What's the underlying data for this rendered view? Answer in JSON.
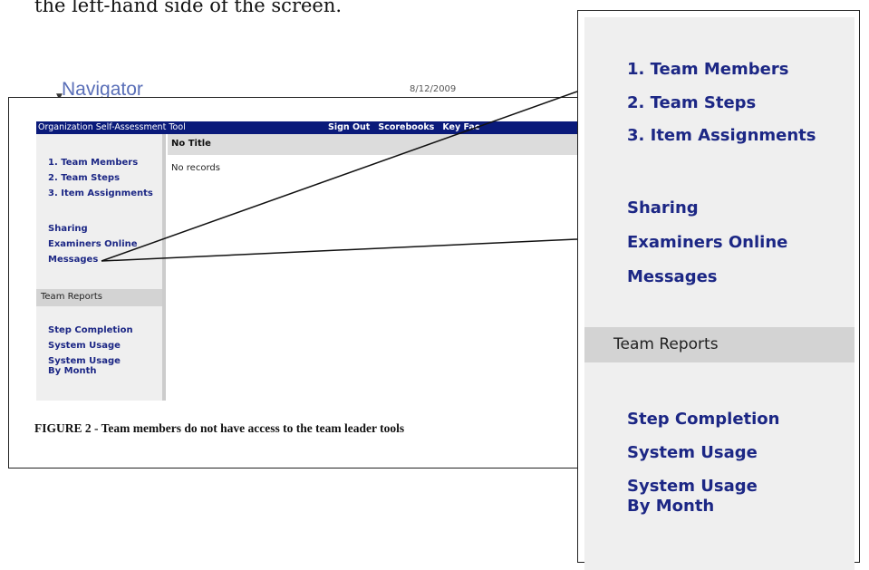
{
  "document": {
    "intro_text": "the left-hand side of the screen.",
    "caption": "FIGURE 2 - Team members do not have access to the team leader tools"
  },
  "browser": {
    "heading": "Navigator",
    "date": "8/12/2009"
  },
  "app": {
    "title": "Organization Self-Assessment Tool",
    "top_links": [
      "Sign Out",
      "Scorebooks",
      "Key Fac"
    ],
    "bar_color": "#0a1a7a"
  },
  "sidebar": {
    "team_links": [
      "1. Team Members",
      "2. Team Steps",
      "3. Item Assignments"
    ],
    "general_links": [
      "Sharing",
      "Examiners Online",
      "Messages"
    ],
    "section_title": "Team Reports",
    "report_links": [
      "Step Completion",
      "System Usage",
      "System Usage\nBy Month"
    ]
  },
  "content": {
    "header": "No Title",
    "empty_text": "No records"
  },
  "zoom": {
    "team_links": [
      "1. Team Members",
      "2. Team Steps",
      "3. Item Assignments"
    ],
    "general_links": [
      "Sharing",
      "Examiners Online",
      "Messages"
    ],
    "section_title": "Team Reports",
    "report_links": [
      "Step Completion",
      "System Usage",
      "System Usage",
      "By Month"
    ]
  }
}
